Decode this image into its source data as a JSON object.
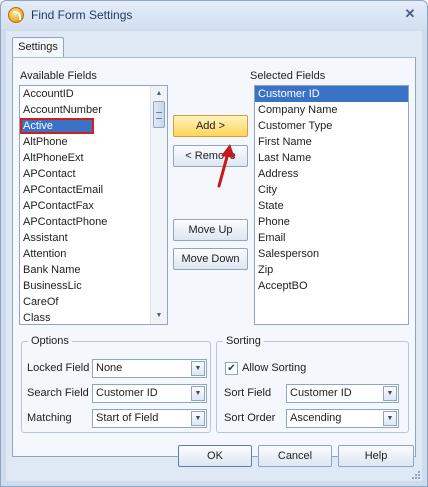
{
  "window": {
    "title": "Find Form Settings",
    "close_glyph": "✕"
  },
  "tabs": [
    {
      "label": "Settings"
    }
  ],
  "available": {
    "label": "Available Fields",
    "items": [
      "AccountID",
      "AccountNumber",
      "Active",
      "AltPhone",
      "AltPhoneExt",
      "APContact",
      "APContactEmail",
      "APContactFax",
      "APContactPhone",
      "Assistant",
      "Attention",
      "Bank Name",
      "BusinessLic",
      "CareOf",
      "Class"
    ],
    "selected": "Active"
  },
  "selected_fields": {
    "label": "Selected Fields",
    "items": [
      "Customer ID",
      "Company Name",
      "Customer Type",
      "First Name",
      "Last Name",
      "Address",
      "City",
      "State",
      "Phone",
      "Email",
      "Salesperson",
      "Zip",
      "AcceptBO"
    ],
    "selected": "Customer ID"
  },
  "buttons": {
    "add": "Add >",
    "remove": "< Remove",
    "move_up": "Move Up",
    "move_down": "Move Down",
    "ok": "OK",
    "cancel": "Cancel",
    "help": "Help"
  },
  "options": {
    "title": "Options",
    "locked_label": "Locked Field",
    "locked_value": "None",
    "search_label": "Search Field",
    "search_value": "Customer ID",
    "matching_label": "Matching",
    "matching_value": "Start of Field"
  },
  "sorting": {
    "title": "Sorting",
    "allow_label": "Allow Sorting",
    "allow_checked": true,
    "check_glyph": "✔",
    "sort_field_label": "Sort Field",
    "sort_field_value": "Customer ID",
    "sort_order_label": "Sort Order",
    "sort_order_value": "Ascending"
  },
  "glyphs": {
    "scroll_up": "▲",
    "scroll_down": "▼",
    "dropdown": "▼"
  },
  "icons": {
    "app": "app-icon",
    "annotation": "red-arrow-icon"
  },
  "colors": {
    "selection": "#3a72c6",
    "highlight_box": "#d11e1e",
    "add_button": "#ffd45a",
    "frame": "#dfe8f5"
  }
}
